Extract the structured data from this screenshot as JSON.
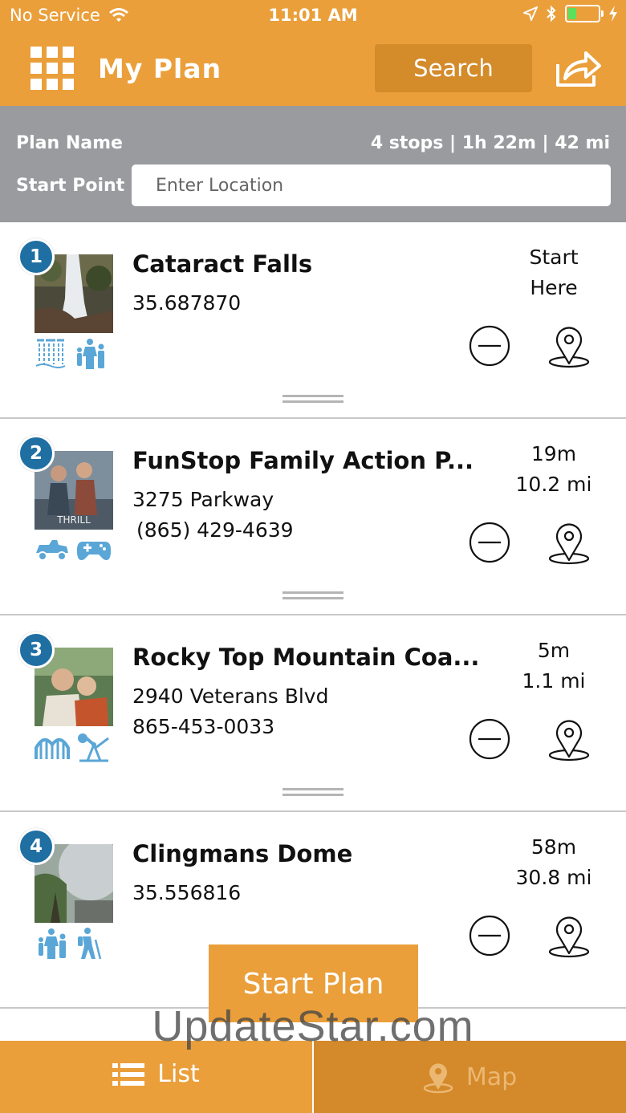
{
  "status_bar": {
    "carrier": "No Service",
    "time": "11:01 AM"
  },
  "header": {
    "title": "My Plan",
    "search_label": "Search"
  },
  "plan": {
    "name_label": "Plan Name",
    "stats": "4 stops | 1h 22m | 42 mi",
    "start_label": "Start Point",
    "start_placeholder": "Enter Location"
  },
  "stops": [
    {
      "number": "1",
      "name": "Cataract Falls",
      "line1": "35.687870",
      "line2": "",
      "time": "Start",
      "distance": "Here",
      "icons": [
        "waterfall-icon",
        "family-icon"
      ]
    },
    {
      "number": "2",
      "name": "FunStop Family Action P...",
      "line1": "3275 Parkway",
      "line2": "(865) 429-4639",
      "time": "19m",
      "distance": "10.2 mi",
      "icons": [
        "go-kart-icon",
        "gamepad-icon"
      ]
    },
    {
      "number": "3",
      "name": "Rocky Top Mountain Coa...",
      "line1": "2940 Veterans Blvd",
      "line2": "865-453-0033",
      "time": "5m",
      "distance": "1.1 mi",
      "icons": [
        "roller-coaster-icon",
        "ride-icon"
      ]
    },
    {
      "number": "4",
      "name": "Clingmans Dome",
      "line1": "35.556816",
      "line2": "",
      "time": "58m",
      "distance": "30.8 mi",
      "icons": [
        "family-icon",
        "hiker-icon"
      ]
    }
  ],
  "actions": {
    "start_plan": "Start Plan"
  },
  "watermark": "UpdateStar.com",
  "tabs": {
    "list_label": "List",
    "map_label": "Map"
  },
  "colors": {
    "accent": "#EA9F3A",
    "accent_dark": "#D48B2A",
    "badge": "#1F6FA3",
    "icon_blue": "#5AA6D6",
    "planbar_gray": "#999B9E"
  }
}
